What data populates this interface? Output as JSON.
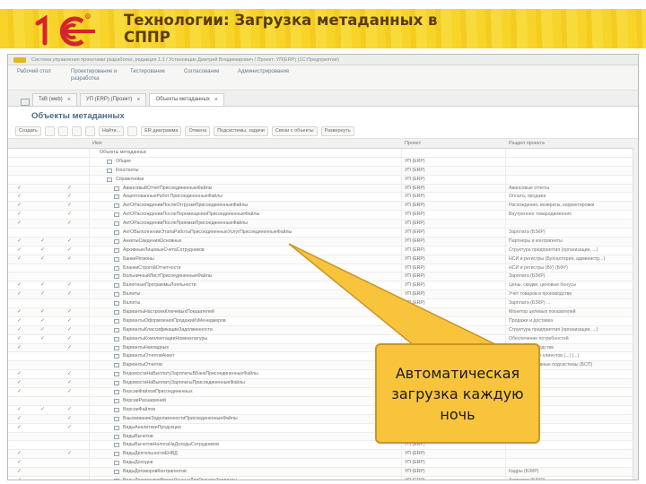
{
  "slide": {
    "title": "Технологии: Загрузка метаданных в СППР",
    "logo_text": "1С"
  },
  "window": {
    "titlebar": "Система управления проектами разработки, редакция 1.1 / Установщик Дмитрий Владимирович / Проект: УП(ERP) (1С:Предприятие)",
    "sections": [
      "Рабочий стол",
      "Проектирование и разработка",
      "Тестирование",
      "Согласование",
      "Администрирование"
    ],
    "tabs": [
      {
        "label": "ТкВ (web)",
        "active": false
      },
      {
        "label": "УП (ERP) (Проект)",
        "active": false
      },
      {
        "label": "Объекты метаданных",
        "active": true
      }
    ],
    "form_title": "Объекты метаданных",
    "toolbar": [
      "Создать",
      "Найти...",
      "ER диаграмма",
      "Отмена",
      "Подсистемы, задачи",
      "Связи с объекты",
      "Развернуть"
    ],
    "columns": {
      "name": "Имя",
      "project": "Проект",
      "section": "Раздел проекта"
    },
    "tree_root": "Объекты метаданных",
    "tree_groups": [
      "Общие",
      "Константы",
      "Справочники"
    ],
    "rows": [
      {
        "name": "АвансовыйОтчетПрисоединенныеФайлы",
        "project": "УП (ERP)",
        "section": "Авансовые отчеты",
        "checks": [
          true,
          false,
          true
        ]
      },
      {
        "name": "АкцептованныеРабот.ПрисоединенныеФайлы",
        "project": "УП (ERP)",
        "section": "Оплата, продажи",
        "checks": [
          true,
          false,
          true
        ]
      },
      {
        "name": "АктОРасхожденииПослеОтгрузкиПрисоединенныеФайлы",
        "project": "УП (ERP)",
        "section": "Расхождения, возвраты, корректировки",
        "checks": [
          true,
          false,
          true
        ]
      },
      {
        "name": "АктОРасхожденииПослеПеремещенияПрисоединенныеФайлы",
        "project": "УП (ERP)",
        "section": "Внутреннее товародвижение",
        "checks": [
          true,
          false,
          true
        ]
      },
      {
        "name": "АктОРасхожденииПослеПриемкиПрисоединенныеФайлы",
        "project": "УП (ERP)",
        "section": "",
        "checks": [
          true,
          false,
          true
        ]
      },
      {
        "name": "АктОВыполненииЭтапаРаботыПрисоединенныеУслугПрисоединенныеФайлы",
        "project": "УП (ERP)",
        "section": "Зарплата (БЗКР)",
        "checks": [
          false,
          false,
          false
        ]
      },
      {
        "name": "АнкетыСведенияОсновных",
        "project": "УП (ERP)",
        "section": "Партнеры и контрагенты",
        "checks": [
          true,
          true,
          true
        ]
      },
      {
        "name": "АрхивныеЛицевыеСчетаСотрудников",
        "project": "УП (ERP)",
        "section": "Структура предприятия (организации, ...)",
        "checks": [
          true,
          true,
          true
        ]
      },
      {
        "name": "БанкиРегионы",
        "project": "УП (ERP)",
        "section": "НСИ и регистры (Бухгалтерия, администр...)",
        "checks": [
          true,
          true,
          true
        ]
      },
      {
        "name": "БланкиСтрогойОтчетности",
        "project": "УП (ERP)",
        "section": "НСИ и регистры (БУ) (БФУ)",
        "checks": [
          false,
          false,
          false
        ]
      },
      {
        "name": "БольничныйЛистПрисоединенныеФайлы",
        "project": "УП (ERP)",
        "section": "Зарплата (БЗКР)",
        "checks": [
          false,
          false,
          false
        ]
      },
      {
        "name": "ВалютныеПрограммыЛояльности",
        "project": "УП (ERP)",
        "section": "Цены, скидки, ценовые бонусы",
        "checks": [
          true,
          true,
          true
        ]
      },
      {
        "name": "Валюты",
        "project": "УП (ERP)",
        "section": "Учет товаров в производстве",
        "checks": [
          true,
          true,
          true
        ]
      },
      {
        "name": "Валюты",
        "project": "УП (ERP)",
        "section": "Зарплата (БЗКР) ...",
        "checks": [
          false,
          false,
          false
        ]
      },
      {
        "name": "ВариантыНастроекКлючевыхПоказателей",
        "project": "УП (ERP)",
        "section": "Монитор целевых показателей",
        "checks": [
          true,
          true,
          true
        ]
      },
      {
        "name": "ВариантыОформленияПродажиИзМенеджеров",
        "project": "УП (ERP)",
        "section": "Продажи и доставка",
        "checks": [
          true,
          true,
          true
        ]
      },
      {
        "name": "ВариантыКлассификацииЗадолженности",
        "project": "УП (ERP)",
        "section": "Структура предприятия (организации, ...)",
        "checks": [
          true,
          true,
          true
        ]
      },
      {
        "name": "ВариантыКомплектацииНоменклатуры",
        "project": "УП (ERP)",
        "section": "Обеспечение потребностей",
        "checks": [
          true,
          true,
          true
        ]
      },
      {
        "name": "ВариантыНакладных",
        "project": "УП (ERP)",
        "section": "НСИ и производства",
        "checks": [
          true,
          false,
          true
        ]
      },
      {
        "name": "ВариантыОтчетовАнкет",
        "project": "УП (ERP)",
        "section": "Анкетирование клиентов (...) (...)",
        "checks": [
          false,
          false,
          false
        ]
      },
      {
        "name": "ВариантыОтчетов",
        "project": "УП (ERP)",
        "section": "Административные подсистемы (БСП)",
        "checks": [
          false,
          false,
          false
        ]
      },
      {
        "name": "ВедомостиНаВыплатуЗарплатыВБанкПрисоединенныеФайлы",
        "project": "УП (ERP)",
        "section": "",
        "checks": [
          true,
          false,
          true
        ]
      },
      {
        "name": "ВедомостиНаВыплатуЗарплатыПрисоединенныеФайлы",
        "project": "УП (ERP)",
        "section": "",
        "checks": [
          true,
          false,
          true
        ]
      },
      {
        "name": "ВерсииФайловПрисоединенных",
        "project": "УП (ERP)",
        "section": "",
        "checks": [
          true,
          false,
          true
        ]
      },
      {
        "name": "ВерсииРасширений",
        "project": "УП (ERP)",
        "section": "",
        "checks": [
          false,
          false,
          false
        ]
      },
      {
        "name": "ВерсииФайлов",
        "project": "УП (ERP)",
        "section": "",
        "checks": [
          true,
          true,
          true
        ]
      },
      {
        "name": "ВзыскиваниеЗадолженностиПрисоединенныеФайлы",
        "project": "УП (ERP)",
        "section": "",
        "checks": [
          true,
          false,
          true
        ]
      },
      {
        "name": "ВидыАналитикиПродукции",
        "project": "УП (ERP)",
        "section": "",
        "checks": [
          true,
          false,
          true
        ]
      },
      {
        "name": "ВидыВычетов",
        "project": "УП (ERP)",
        "section": "",
        "checks": [
          false,
          false,
          false
        ]
      },
      {
        "name": "ВидыВычетовНалогаНаДоходыСотрудников",
        "project": "УП (ERP)",
        "section": "",
        "checks": [
          false,
          false,
          false
        ]
      },
      {
        "name": "ВидыДеятельностиЕНВД",
        "project": "УП (ERP)",
        "section": "",
        "checks": [
          true,
          false,
          true
        ]
      },
      {
        "name": "ВидыДоходов",
        "project": "УП (ERP)",
        "section": "",
        "checks": [
          true,
          false,
          false
        ]
      },
      {
        "name": "ВидыДоговоровКонтрагентов",
        "project": "УП (ERP)",
        "section": "Кадры (БЗКР)",
        "checks": [
          true,
          false,
          false
        ]
      },
      {
        "name": "ВидыДокументовВводаДанныхДляРасчетаЗарплаты",
        "project": "УП (ERP)",
        "section": "Зарплата (БЗКР)",
        "checks": [
          true,
          false,
          false
        ]
      },
      {
        "name": "ВидыДокументовФизическихЛиц",
        "project": "УП (ERP)",
        "section": "Кадры (БЗКР)",
        "checks": [
          true,
          false,
          false
        ]
      }
    ]
  },
  "callout": {
    "text": "Автоматическая загрузка каждую ночь"
  },
  "colors": {
    "accent_yellow": "#f6d21e",
    "callout_fill": "#f7c43c",
    "logo_red": "#d4252a",
    "title_text": "#5a3c10"
  }
}
